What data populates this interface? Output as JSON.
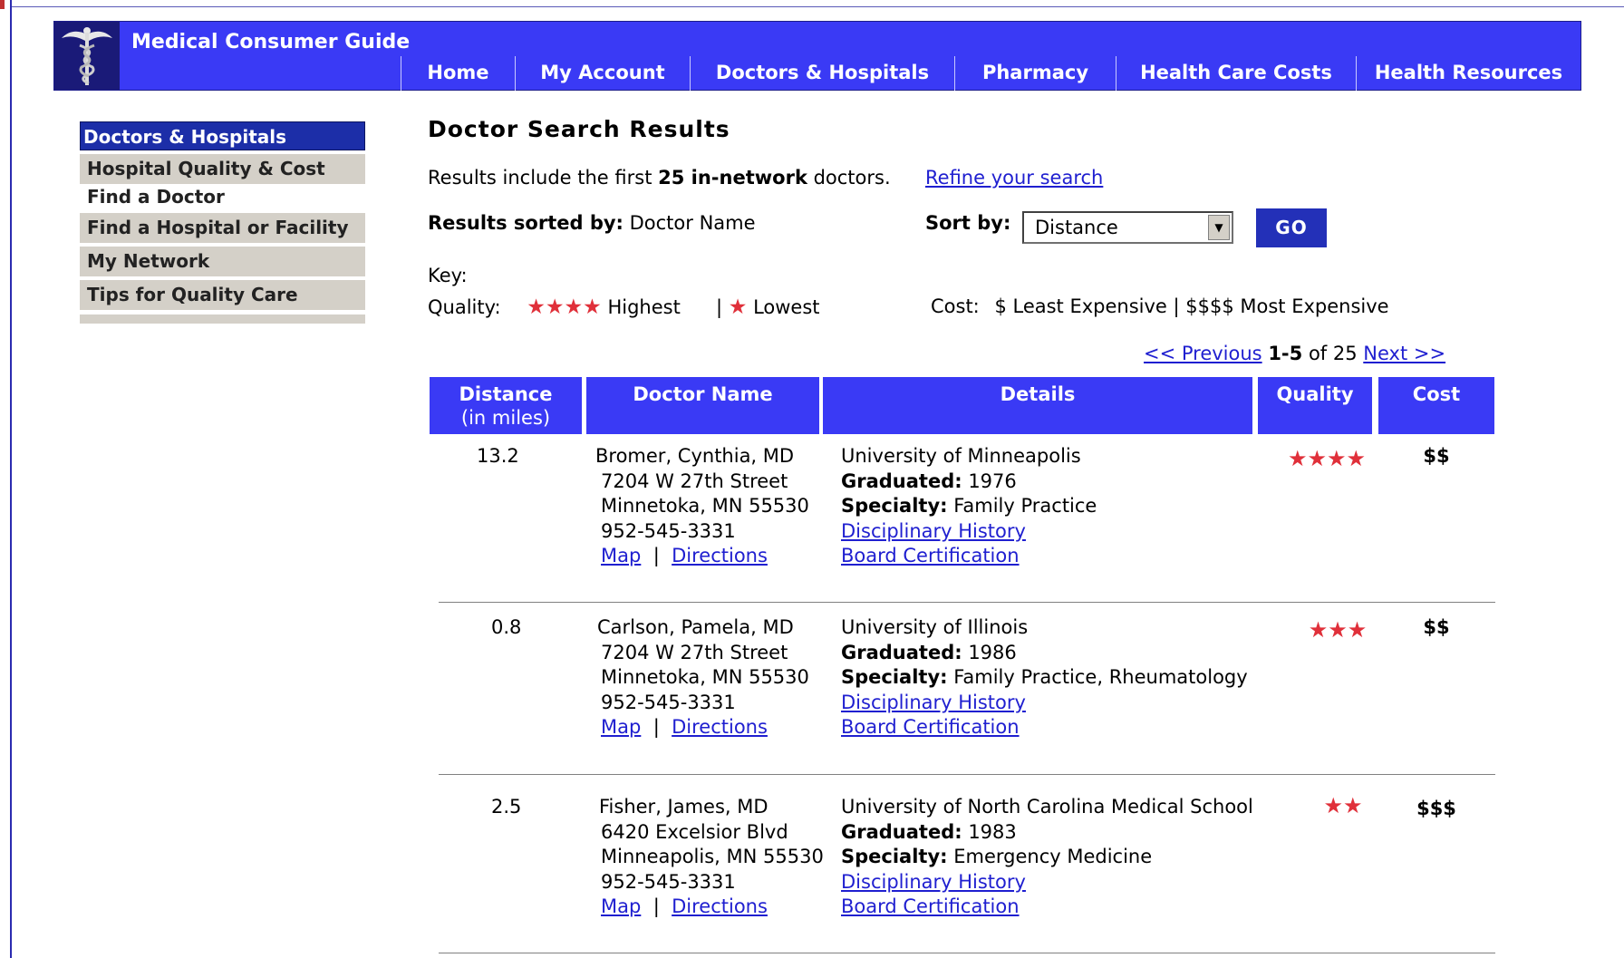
{
  "site": {
    "title": "Medical Consumer Guide",
    "logo": "caduceus-logo"
  },
  "nav": [
    "Home",
    "My Account",
    "Doctors & Hospitals",
    "Pharmacy",
    "Health Care Costs",
    "Health Resources"
  ],
  "sidebar": {
    "heading": "Doctors & Hospitals",
    "items": [
      "Hospital Quality & Cost",
      "Find a Doctor",
      "Find a Hospital or Facility",
      "My Network",
      "Tips for Quality Care"
    ]
  },
  "main": {
    "title": "Doctor Search Results",
    "intro_prefix": "Results include the first ",
    "intro_bold": "25 in-network",
    "intro_suffix": " doctors.",
    "refine_link": "Refine your search",
    "sorted_label": "Results sorted by:",
    "sorted_value": " Doctor Name",
    "sort_by_label": "Sort by:",
    "sort_selected": "Distance",
    "go_label": "GO",
    "key_label": "Key:",
    "quality_label": "Quality:",
    "quality_high_stars": "★★★★",
    "quality_high": " Highest",
    "quality_sep": "|",
    "quality_low_star": "★",
    "quality_low": " Lowest",
    "cost_label": "Cost:",
    "cost_key": "$ Least Expensive | $$$$ Most Expensive",
    "pager": {
      "prev": "<< Previous",
      "range": "1-5",
      "of": " of 25 ",
      "next": "Next >>"
    }
  },
  "table": {
    "headers": {
      "distance": "Distance",
      "distance_sub": "(in miles)",
      "name": "Doctor Name",
      "details": "Details",
      "quality": "Quality",
      "cost": "Cost"
    },
    "link_labels": {
      "map": "Map",
      "directions": "Directions",
      "disciplinary": "Disciplinary History",
      "board": "Board Certification",
      "sep": "|"
    },
    "field_labels": {
      "graduated": "Graduated:",
      "specialty": "Specialty:"
    },
    "rows": [
      {
        "distance": "13.2",
        "name": "Bromer, Cynthia, MD",
        "address1": "7204 W 27th Street",
        "address2": "Minnetoka, MN 55530",
        "phone": "952-545-3331",
        "school": "University of Minneapolis",
        "graduated": " 1976",
        "specialty": " Family Practice",
        "quality": "★★★★",
        "quality_rating": 4,
        "cost": "$$"
      },
      {
        "distance": "0.8",
        "name": "Carlson, Pamela, MD",
        "address1": "7204 W 27th Street",
        "address2": "Minnetoka, MN 55530",
        "phone": "952-545-3331",
        "school": "University of Illinois",
        "graduated": " 1986",
        "specialty": " Family Practice, Rheumatology",
        "quality": "★★★",
        "quality_rating": 3,
        "cost": "$$"
      },
      {
        "distance": "2.5",
        "name": "Fisher, James, MD",
        "address1": "6420 Excelsior Blvd",
        "address2": "Minneapolis, MN 55530",
        "phone": "952-545-3331",
        "school": "University of North Carolina Medical School",
        "graduated": " 1983",
        "specialty": " Emergency Medicine",
        "quality": "★★",
        "quality_rating": 2,
        "cost": "$$$"
      }
    ]
  },
  "colors": {
    "nav_blue": "#3a3af5",
    "dark_blue": "#1c2ea8",
    "star_red": "#e0303a",
    "link_blue": "#1f1fd0"
  }
}
